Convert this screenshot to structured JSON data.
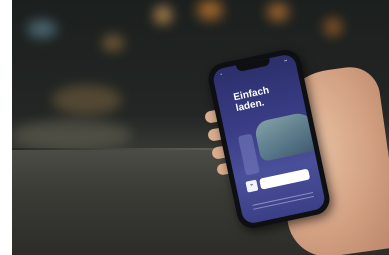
{
  "photo": {
    "subject": "hand-holding-smartphone-in-cafe",
    "app_screen": {
      "headline": "Einfach laden.",
      "button_label": "",
      "fineprint_lines": []
    }
  },
  "colors": {
    "screen_top": "#2c2f6b",
    "screen_bottom": "#3b3f87",
    "button": "#ffffff",
    "bokeh_warm": "#d58a3a"
  }
}
